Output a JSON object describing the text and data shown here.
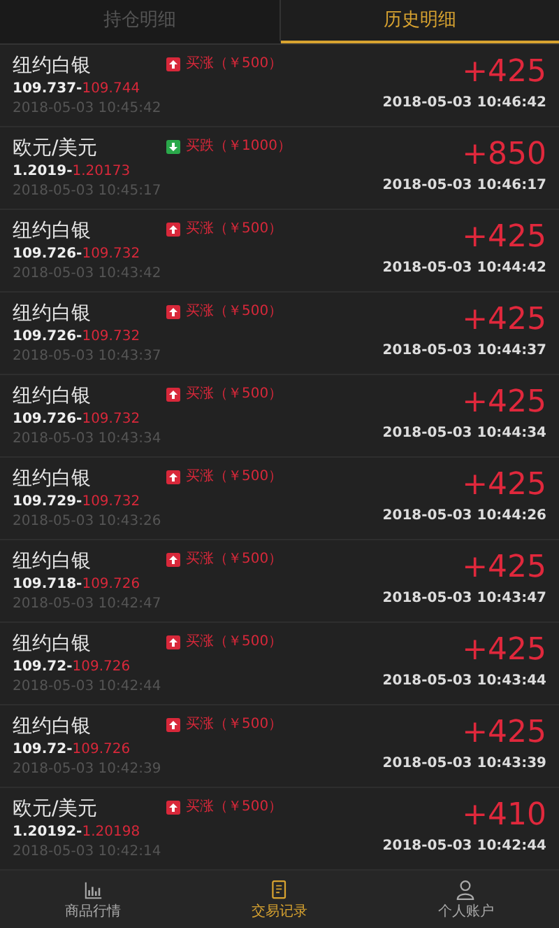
{
  "tabs": [
    {
      "label": "持仓明细",
      "selected": false
    },
    {
      "label": "历史明细",
      "selected": true
    }
  ],
  "records": [
    {
      "name": "纽约白银",
      "kind": "up",
      "order": "买涨（￥500）",
      "open_price": "109.737-",
      "close_price": "109.744",
      "open_time": "2018-05-03 10:45:42",
      "profit": "+425",
      "close_time": "2018-05-03 10:46:42"
    },
    {
      "name": "欧元/美元",
      "kind": "down",
      "order": "买跌（￥1000）",
      "open_price": "1.2019-",
      "close_price": "1.20173",
      "open_time": "2018-05-03 10:45:17",
      "profit": "+850",
      "close_time": "2018-05-03 10:46:17"
    },
    {
      "name": "纽约白银",
      "kind": "up",
      "order": "买涨（￥500）",
      "open_price": "109.726-",
      "close_price": "109.732",
      "open_time": "2018-05-03 10:43:42",
      "profit": "+425",
      "close_time": "2018-05-03 10:44:42"
    },
    {
      "name": "纽约白银",
      "kind": "up",
      "order": "买涨（￥500）",
      "open_price": "109.726-",
      "close_price": "109.732",
      "open_time": "2018-05-03 10:43:37",
      "profit": "+425",
      "close_time": "2018-05-03 10:44:37"
    },
    {
      "name": "纽约白银",
      "kind": "up",
      "order": "买涨（￥500）",
      "open_price": "109.726-",
      "close_price": "109.732",
      "open_time": "2018-05-03 10:43:34",
      "profit": "+425",
      "close_time": "2018-05-03 10:44:34"
    },
    {
      "name": "纽约白银",
      "kind": "up",
      "order": "买涨（￥500）",
      "open_price": "109.729-",
      "close_price": "109.732",
      "open_time": "2018-05-03 10:43:26",
      "profit": "+425",
      "close_time": "2018-05-03 10:44:26"
    },
    {
      "name": "纽约白银",
      "kind": "up",
      "order": "买涨（￥500）",
      "open_price": "109.718-",
      "close_price": "109.726",
      "open_time": "2018-05-03 10:42:47",
      "profit": "+425",
      "close_time": "2018-05-03 10:43:47"
    },
    {
      "name": "纽约白银",
      "kind": "up",
      "order": "买涨（￥500）",
      "open_price": "109.72-",
      "close_price": "109.726",
      "open_time": "2018-05-03 10:42:44",
      "profit": "+425",
      "close_time": "2018-05-03 10:43:44"
    },
    {
      "name": "纽约白银",
      "kind": "up",
      "order": "买涨（￥500）",
      "open_price": "109.72-",
      "close_price": "109.726",
      "open_time": "2018-05-03 10:42:39",
      "profit": "+425",
      "close_time": "2018-05-03 10:43:39"
    },
    {
      "name": "欧元/美元",
      "kind": "up",
      "order": "买涨（￥500）",
      "open_price": "1.20192-",
      "close_price": "1.20198",
      "open_time": "2018-05-03 10:42:14",
      "profit": "+410",
      "close_time": "2018-05-03 10:42:44"
    }
  ],
  "nav": [
    {
      "kind": "chart",
      "label": "商品行情",
      "selected": false
    },
    {
      "kind": "record",
      "label": "交易记录",
      "selected": true
    },
    {
      "kind": "person",
      "label": "个人账户",
      "selected": false
    }
  ]
}
